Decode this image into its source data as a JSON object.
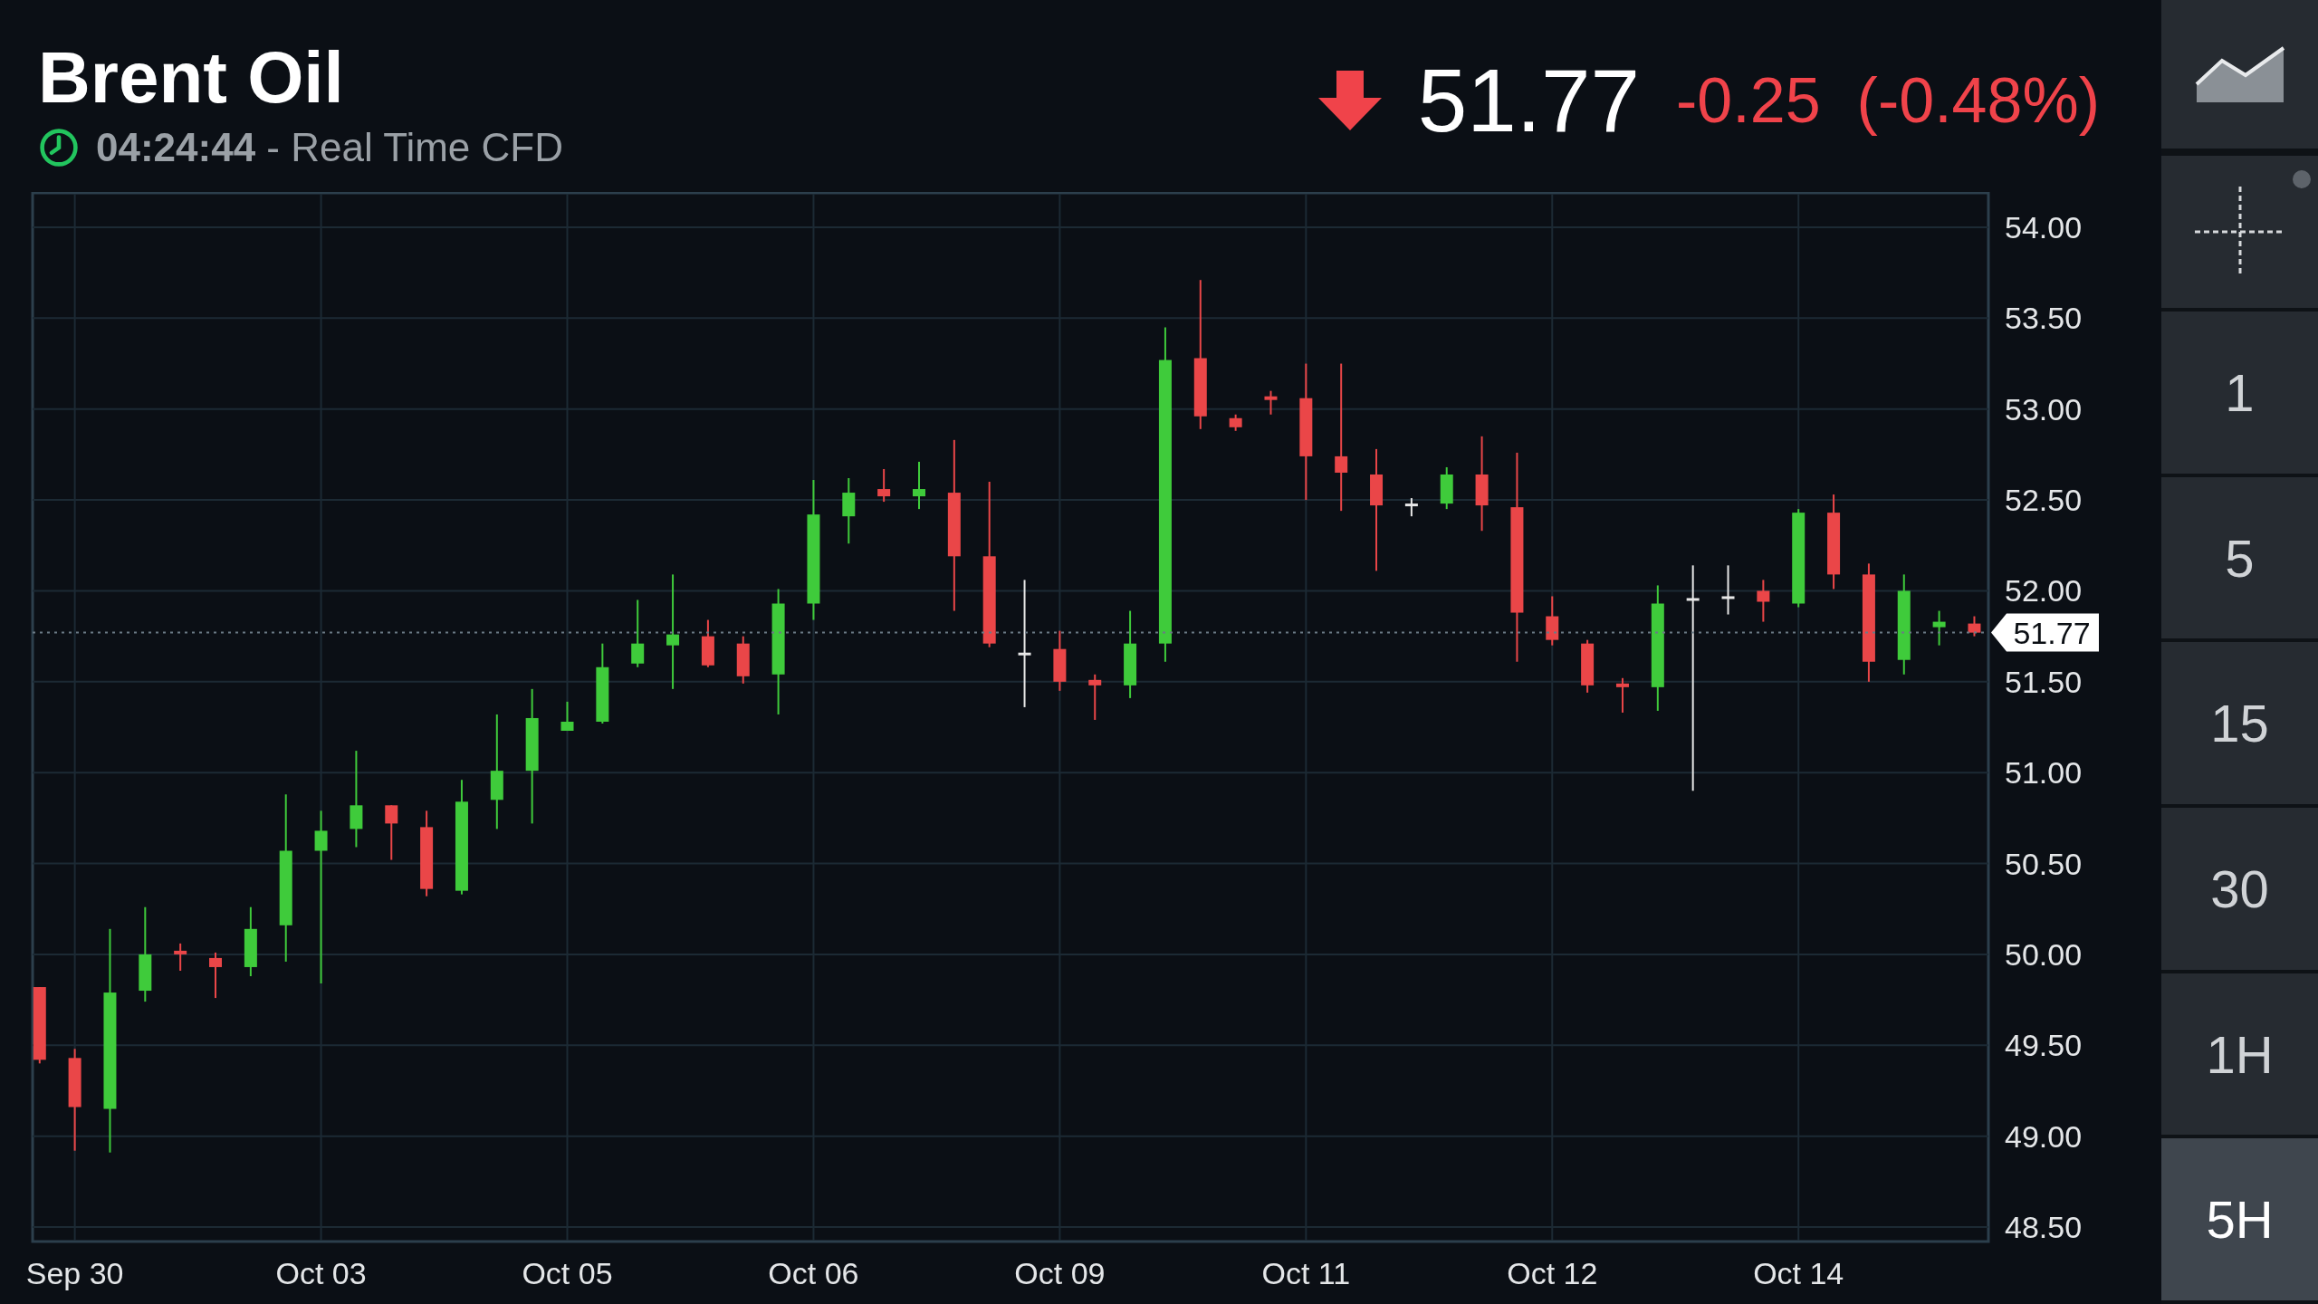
{
  "header": {
    "title": "Brent Oil",
    "time": "04:24:44",
    "separator": " - ",
    "feed": "Real Time CFD",
    "down": true,
    "price": "51.77",
    "change": "-0.25",
    "change_percent": "(-0.48%)"
  },
  "chart": {
    "chart_data": {
      "type": "candlestick",
      "grid": true,
      "ylim": [
        48.5,
        54.0
      ],
      "yticks": [
        {
          "value": 48.5,
          "label": "48.50"
        },
        {
          "value": 49.0,
          "label": "49.00"
        },
        {
          "value": 49.5,
          "label": "49.50"
        },
        {
          "value": 50.0,
          "label": "50.00"
        },
        {
          "value": 50.5,
          "label": "50.50"
        },
        {
          "value": 51.0,
          "label": "51.00"
        },
        {
          "value": 51.5,
          "label": "51.50"
        },
        {
          "value": 52.0,
          "label": "52.00"
        },
        {
          "value": 52.5,
          "label": "52.50"
        },
        {
          "value": 53.0,
          "label": "53.00"
        },
        {
          "value": 53.5,
          "label": "53.50"
        },
        {
          "value": 54.0,
          "label": "54.00"
        }
      ],
      "categories": [
        null,
        "Sep 30",
        null,
        null,
        null,
        null,
        null,
        null,
        "Oct 03",
        null,
        null,
        null,
        null,
        null,
        null,
        "Oct 05",
        null,
        null,
        null,
        null,
        null,
        null,
        "Oct 06",
        null,
        null,
        null,
        null,
        null,
        null,
        "Oct 09",
        null,
        null,
        null,
        null,
        null,
        null,
        "Oct 11",
        null,
        null,
        null,
        null,
        null,
        null,
        "Oct 12",
        null,
        null,
        null,
        null,
        null,
        null,
        "Oct 14",
        null,
        null,
        null,
        null,
        null
      ],
      "ohlc": [
        [
          49.82,
          49.82,
          49.4,
          49.42
        ],
        [
          49.43,
          49.48,
          48.92,
          49.16
        ],
        [
          49.15,
          50.14,
          48.91,
          49.79
        ],
        [
          49.8,
          50.26,
          49.74,
          50.0
        ],
        [
          50.02,
          50.06,
          49.91,
          50.0
        ],
        [
          49.98,
          50.01,
          49.76,
          49.93
        ],
        [
          49.93,
          50.26,
          49.88,
          50.14
        ],
        [
          50.16,
          50.88,
          49.96,
          50.57
        ],
        [
          50.57,
          50.79,
          49.84,
          50.68
        ],
        [
          50.69,
          51.12,
          50.59,
          50.82
        ],
        [
          50.82,
          50.82,
          50.52,
          50.72
        ],
        [
          50.7,
          50.79,
          50.32,
          50.36
        ],
        [
          50.35,
          50.96,
          50.33,
          50.84
        ],
        [
          50.85,
          51.32,
          50.69,
          51.01
        ],
        [
          51.01,
          51.46,
          50.72,
          51.3
        ],
        [
          51.23,
          51.39,
          51.23,
          51.28
        ],
        [
          51.28,
          51.71,
          51.27,
          51.58
        ],
        [
          51.6,
          51.95,
          51.58,
          51.71
        ],
        [
          51.7,
          52.09,
          51.46,
          51.76
        ],
        [
          51.75,
          51.84,
          51.58,
          51.59
        ],
        [
          51.71,
          51.75,
          51.49,
          51.53
        ],
        [
          51.54,
          52.01,
          51.32,
          51.93
        ],
        [
          51.93,
          52.61,
          51.84,
          52.42
        ],
        [
          52.41,
          52.62,
          52.26,
          52.54
        ],
        [
          52.56,
          52.67,
          52.49,
          52.52
        ],
        [
          52.52,
          52.71,
          52.45,
          52.56
        ],
        [
          52.54,
          52.83,
          51.89,
          52.19
        ],
        [
          52.19,
          52.6,
          51.69,
          51.71
        ],
        [
          51.66,
          52.06,
          51.36,
          51.66
        ],
        [
          51.68,
          51.78,
          51.45,
          51.5
        ],
        [
          51.51,
          51.54,
          51.29,
          51.48
        ],
        [
          51.48,
          51.89,
          51.41,
          51.71
        ],
        [
          51.71,
          53.45,
          51.61,
          53.27
        ],
        [
          53.28,
          53.71,
          52.89,
          52.96
        ],
        [
          52.95,
          52.97,
          52.88,
          52.9
        ],
        [
          53.07,
          53.1,
          52.97,
          53.05
        ],
        [
          53.06,
          53.25,
          52.5,
          52.74
        ],
        [
          52.74,
          53.25,
          52.44,
          52.65
        ],
        [
          52.64,
          52.78,
          52.11,
          52.47
        ],
        [
          52.48,
          52.51,
          52.41,
          52.48
        ],
        [
          52.48,
          52.68,
          52.45,
          52.64
        ],
        [
          52.64,
          52.85,
          52.33,
          52.47
        ],
        [
          52.46,
          52.76,
          51.61,
          51.88
        ],
        [
          51.86,
          51.97,
          51.7,
          51.73
        ],
        [
          51.71,
          51.73,
          51.44,
          51.48
        ],
        [
          51.49,
          51.52,
          51.33,
          51.47
        ],
        [
          51.47,
          52.03,
          51.34,
          51.93
        ],
        [
          51.96,
          52.14,
          50.9,
          51.96
        ],
        [
          51.97,
          52.14,
          51.87,
          51.97
        ],
        [
          52.0,
          52.06,
          51.83,
          51.94
        ],
        [
          51.93,
          52.45,
          51.91,
          52.43
        ],
        [
          52.43,
          52.53,
          52.01,
          52.09
        ],
        [
          52.09,
          52.15,
          51.5,
          51.61
        ],
        [
          51.62,
          52.09,
          51.54,
          52.0
        ],
        [
          51.8,
          51.89,
          51.7,
          51.83
        ],
        [
          51.82,
          51.86,
          51.75,
          51.77
        ]
      ],
      "ref_lines": [
        {
          "axis": "y",
          "value": 51.77,
          "label": "51.77"
        }
      ]
    }
  },
  "sidebar": {
    "tools": [
      {
        "kind": "chart-type"
      },
      {
        "kind": "crosshair",
        "on": false
      }
    ],
    "intervals": [
      {
        "label": "1",
        "selected": false
      },
      {
        "label": "5",
        "selected": false
      },
      {
        "label": "15",
        "selected": false
      },
      {
        "label": "30",
        "selected": false
      },
      {
        "label": "1H",
        "selected": false
      },
      {
        "label": "5H",
        "selected": true
      }
    ]
  }
}
